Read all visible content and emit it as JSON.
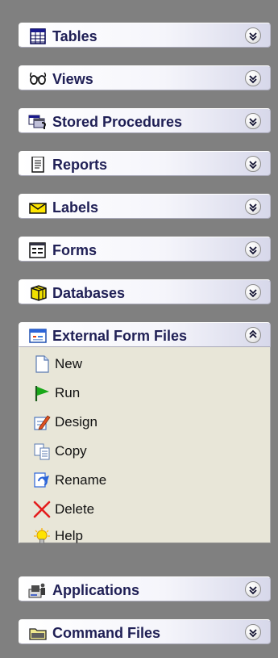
{
  "groups": [
    {
      "label": "Tables",
      "icon": "table-icon",
      "state": "collapsed"
    },
    {
      "label": "Views",
      "icon": "glasses-icon",
      "state": "collapsed"
    },
    {
      "label": "Stored Procedures",
      "icon": "stored-procedure-icon",
      "state": "collapsed"
    },
    {
      "label": "Reports",
      "icon": "report-icon",
      "state": "collapsed"
    },
    {
      "label": "Labels",
      "icon": "envelope-icon",
      "state": "collapsed"
    },
    {
      "label": "Forms",
      "icon": "form-icon",
      "state": "collapsed"
    },
    {
      "label": "Databases",
      "icon": "database-icon",
      "state": "collapsed"
    },
    {
      "label": "External Form Files",
      "icon": "external-form-file-icon",
      "state": "expanded"
    },
    {
      "label": "Applications",
      "icon": "applications-icon",
      "state": "collapsed"
    },
    {
      "label": "Command Files",
      "icon": "folder-icon",
      "state": "collapsed"
    }
  ],
  "external_form_file_actions": [
    {
      "label": "New",
      "icon": "new-document-icon"
    },
    {
      "label": "Run",
      "icon": "run-flag-icon"
    },
    {
      "label": "Design",
      "icon": "design-pencil-icon"
    },
    {
      "label": "Copy",
      "icon": "copy-icon"
    },
    {
      "label": "Rename",
      "icon": "rename-icon"
    },
    {
      "label": "Delete",
      "icon": "delete-x-icon"
    },
    {
      "label": "Help",
      "icon": "help-lightbulb-icon"
    }
  ],
  "colors": {
    "header_text": "#202056",
    "body_background": "#e8e6d8",
    "panel_background": "#808080"
  }
}
